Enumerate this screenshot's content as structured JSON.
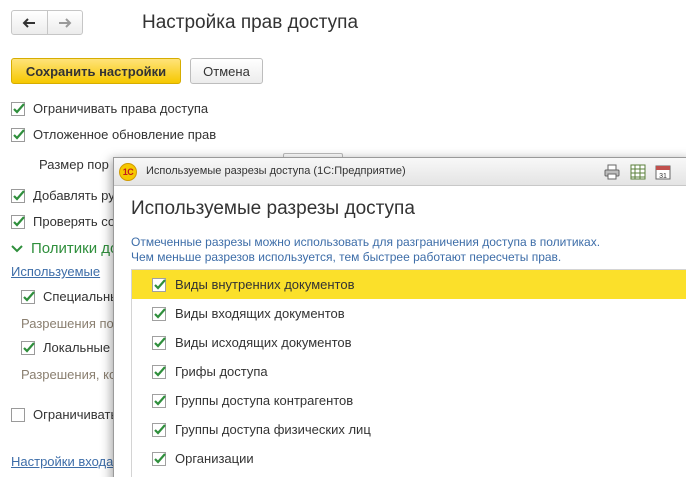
{
  "form": {
    "title": "Настройка прав доступа",
    "save_label": "Сохранить настройки",
    "cancel_label": "Отмена",
    "options": {
      "restrict_access": "Ограничивать права доступа",
      "deferred_update": "Отложенное обновление прав",
      "portion_size": "Размер пор",
      "add_users": "Добавлять ру",
      "check": "Проверять со",
      "restrict2": "Ограничивать"
    },
    "policies_group": "Политики до",
    "used_sections_link": "Используемые",
    "special": "Специальны",
    "permissions_label": "Разрешения по",
    "local": "Локальные",
    "permissions2_label": "Разрешения, ко",
    "input_settings_link": "Настройки входа"
  },
  "dialog": {
    "window_title": "Используемые разрезы доступа  (1С:Предприятие)",
    "logo_text": "1С",
    "heading": "Используемые разрезы доступа",
    "hint_line1": "Отмеченные разрезы можно использовать для разграничения доступа в политиках.",
    "hint_line2": "Чем меньше разрезов используется, тем быстрее работают пересчеты прав.",
    "calendar_day": "31",
    "items": [
      {
        "label": "Виды внутренних документов",
        "checked": true,
        "selected": true
      },
      {
        "label": "Виды входящих документов",
        "checked": true,
        "selected": false
      },
      {
        "label": "Виды исходящих документов",
        "checked": true,
        "selected": false
      },
      {
        "label": "Грифы доступа",
        "checked": true,
        "selected": false
      },
      {
        "label": "Группы доступа контрагентов",
        "checked": true,
        "selected": false
      },
      {
        "label": "Группы доступа физических лиц",
        "checked": true,
        "selected": false
      },
      {
        "label": "Организации",
        "checked": true,
        "selected": false
      }
    ]
  },
  "colors": {
    "accent_yellow": "#f6c800",
    "selection": "#fbe02a",
    "check_green": "#2f8f3c",
    "link_blue": "#3d6da8"
  }
}
